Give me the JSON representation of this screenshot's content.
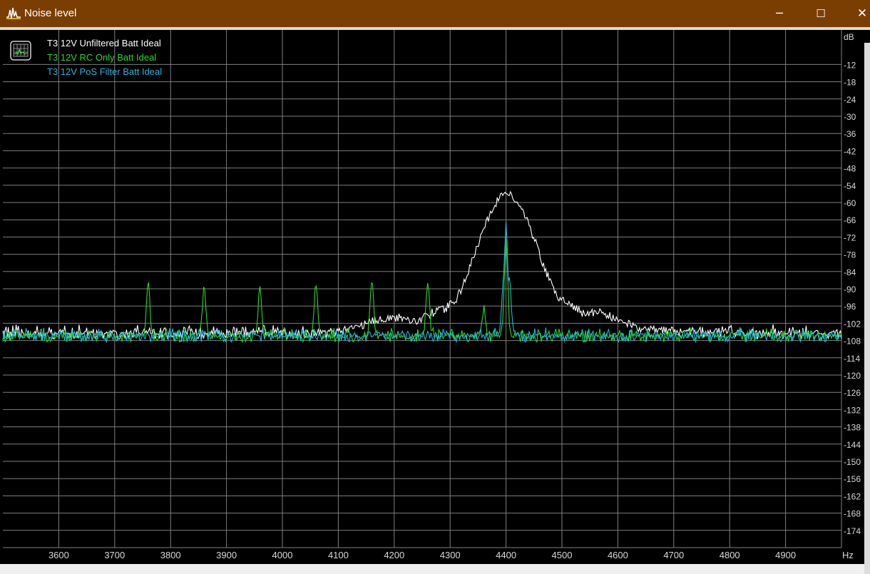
{
  "window": {
    "title": "Noise level",
    "icons": {
      "app": "waveform-app-icon",
      "minimize": "minimize-icon",
      "maximize": "maximize-icon",
      "close": "close-icon"
    },
    "controls": {
      "minimize": "─",
      "maximize": "☐",
      "close": "✕"
    }
  },
  "colors": {
    "titlebar": "#7a3e02",
    "plot_background": "#000000",
    "grid": "#7f7f7f",
    "axis_text": "#d8d8d8"
  },
  "chart_data": {
    "type": "line",
    "title": "",
    "xlabel": "",
    "ylabel": "",
    "x_unit": "Hz",
    "y_unit": "dB",
    "xlim": [
      3500,
      5000
    ],
    "ylim": [
      -180,
      0
    ],
    "x_ticks": [
      3600,
      3700,
      3800,
      3900,
      4000,
      4100,
      4200,
      4300,
      4400,
      4500,
      4600,
      4700,
      4800,
      4900
    ],
    "y_ticks": [
      -12,
      -18,
      -24,
      -30,
      -36,
      -42,
      -48,
      -54,
      -60,
      -66,
      -72,
      -78,
      -84,
      -90,
      -96,
      -102,
      -108,
      -114,
      -120,
      -126,
      -132,
      -138,
      -144,
      -150,
      -156,
      -162,
      -168,
      -174
    ],
    "grid": true,
    "legend": "top-left",
    "series": [
      {
        "name": "T3 12V Unfiltered Batt Ideal",
        "color": "#ffffff",
        "noise_floor": -106,
        "noise_amplitude": 2.5,
        "peaks": [
          {
            "x": 4200,
            "y": -100
          },
          {
            "x": 4300,
            "y": -97
          },
          {
            "x": 4350,
            "y": -90
          },
          {
            "x": 4380,
            "y": -84
          },
          {
            "x": 4395,
            "y": -70
          },
          {
            "x": 4402,
            "y": -57
          },
          {
            "x": 4410,
            "y": -77
          },
          {
            "x": 4440,
            "y": -86
          },
          {
            "x": 4480,
            "y": -93
          },
          {
            "x": 4550,
            "y": -98
          },
          {
            "x": 4650,
            "y": -104
          }
        ]
      },
      {
        "name": "T3 12V RC Only Batt Ideal",
        "color": "#22dd22",
        "noise_floor": -107,
        "noise_amplitude": 2.5,
        "peaks": [
          {
            "x": 3760,
            "y": -89
          },
          {
            "x": 3860,
            "y": -90
          },
          {
            "x": 3960,
            "y": -90
          },
          {
            "x": 4060,
            "y": -89
          },
          {
            "x": 4160,
            "y": -88
          },
          {
            "x": 4260,
            "y": -88
          },
          {
            "x": 4360,
            "y": -97
          },
          {
            "x": 4400,
            "y": -73
          }
        ]
      },
      {
        "name": "T3 12V PoS Filter Batt Ideal",
        "color": "#1fb8e0",
        "noise_floor": -107,
        "noise_amplitude": 2.5,
        "peaks": [
          {
            "x": 4400,
            "y": -67
          },
          {
            "x": 4396,
            "y": -84
          },
          {
            "x": 4406,
            "y": -86
          }
        ]
      }
    ]
  }
}
